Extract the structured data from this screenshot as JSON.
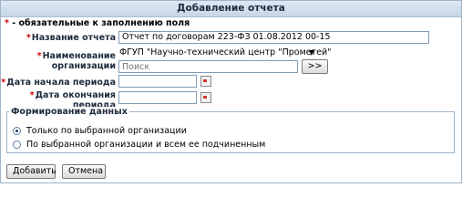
{
  "window": {
    "title": "Добавление отчета"
  },
  "legend": {
    "asterisk": "*",
    "text": " - обязательные к заполнению поля"
  },
  "form": {
    "report_name": {
      "label": "Название отчета",
      "value": "Отчет по договорам 223-ФЗ 01.08.2012 00-15"
    },
    "organization": {
      "label_line1": "Наименование",
      "label_line2": "организации",
      "selected": "ФГУП \"Научно-технический центр \"Прометей\"",
      "search_placeholder": "Поиск",
      "search_value": "",
      "search_button": ">>"
    },
    "period_start": {
      "label": "Дата начала периода",
      "value": ""
    },
    "period_end": {
      "label_line1": "Дата окончания",
      "label_line2": "периода",
      "value": ""
    }
  },
  "data_formation": {
    "title": "Формирование данных",
    "options": [
      {
        "label": "Только по выбранной организации",
        "selected": true
      },
      {
        "label": "По выбранной организации и всем ее подчиненным",
        "selected": false
      }
    ]
  },
  "buttons": {
    "add": "Добавить",
    "cancel": "Отмена"
  },
  "icons": {
    "dropdown": "chevron-down-icon",
    "calendar": "calendar-icon"
  }
}
